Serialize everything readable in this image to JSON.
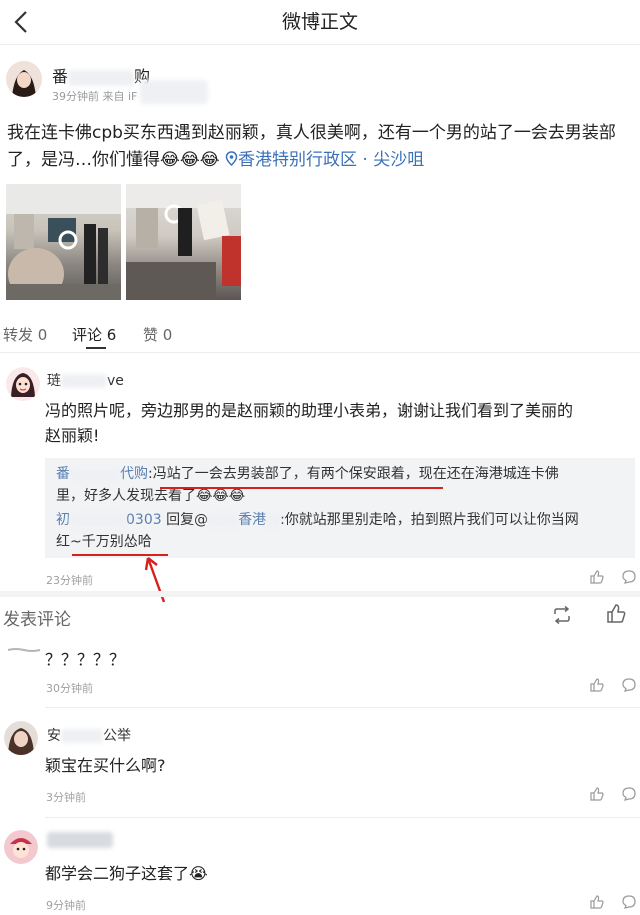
{
  "header": {
    "title": "微博正文"
  },
  "post": {
    "author_name_start": "番",
    "author_name_end": "购",
    "meta_time": "39分钟前",
    "meta_source": "来自 iF",
    "text_line1": "我在连卡佛cpb买东西遇到赵丽颖，真人很美啊，还有一个男的站了一会去男装部",
    "text_line2_prefix": "了，是冯…你们懂得😂😂😂",
    "location": "香港特别行政区 · 尖沙咀"
  },
  "tabs": {
    "repost": "转发 0",
    "comments": "评论 6",
    "likes": "赞 0"
  },
  "comment_main": {
    "name_start": "琏",
    "name_end": "ve",
    "text_line1": "冯的照片呢，旁边那男的是赵丽颖的助理小表弟，谢谢让我们看到了美丽的",
    "text_line2": "赵丽颖!",
    "reply1_name_start": "番",
    "reply1_name_end": "代购",
    "reply1_colon": ":",
    "reply1_highlight": "冯站了一会去男装部了，有两个保安跟着",
    "reply1_rest": "，现在还在海港城连卡佛",
    "reply1_line2": "里，好多人发现去看了😂😂😂",
    "reply2_name_start": "初",
    "reply2_name_end": "0303",
    "reply2_action": "回复@",
    "reply2_target_end": "香港",
    "reply2_text": ":你就站那里别走哈，拍到照片我们可以让你当网",
    "reply2_line2_start": "红~",
    "reply2_line2_highlight": "千万别怂哈",
    "time": "23分钟前"
  },
  "section": {
    "title": "发表评论"
  },
  "comments": [
    {
      "name": "",
      "text": "？？？？？",
      "time": "30分钟前"
    },
    {
      "name_start": "安",
      "name_end": "公举",
      "text": "颖宝在买什么啊?",
      "time": "3分钟前"
    },
    {
      "name": "",
      "text": "都学会二狗子这套了😭",
      "time": "9分钟前"
    }
  ],
  "colors": {
    "accent_red": "#d6221d",
    "link_blue": "#5b7fb0",
    "location_blue": "#3b71b8"
  }
}
